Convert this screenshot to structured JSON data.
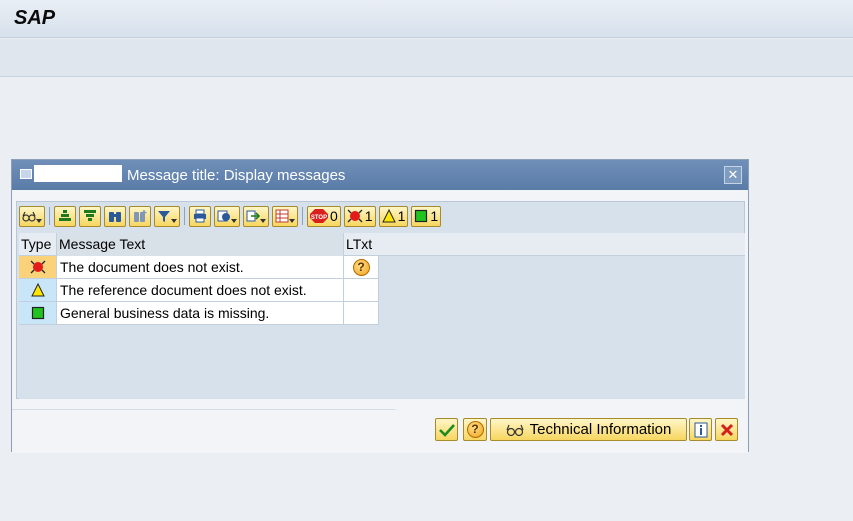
{
  "app": {
    "title": "SAP"
  },
  "dialog": {
    "title": "Message title: Display messages",
    "toolbar": {
      "counts": {
        "stop": "0",
        "error": "1",
        "warning": "1",
        "success": "1"
      }
    },
    "table": {
      "headers": {
        "type": "Type",
        "text": "Message Text",
        "ltxt": "LTxt"
      },
      "rows": [
        {
          "type": "error",
          "text": "The document does not exist.",
          "ltxt": "help"
        },
        {
          "type": "warning",
          "text": "The reference document does not exist.",
          "ltxt": ""
        },
        {
          "type": "success",
          "text": "General business data is missing.",
          "ltxt": ""
        }
      ]
    },
    "footer": {
      "technical_info_label": "Technical Information"
    }
  },
  "colors": {
    "header_blue": "#5a7ca8",
    "button_yellow": "#f7d660",
    "error_red": "#e21b1b",
    "warning_yellow": "#ffe600",
    "success_green": "#21c321"
  }
}
